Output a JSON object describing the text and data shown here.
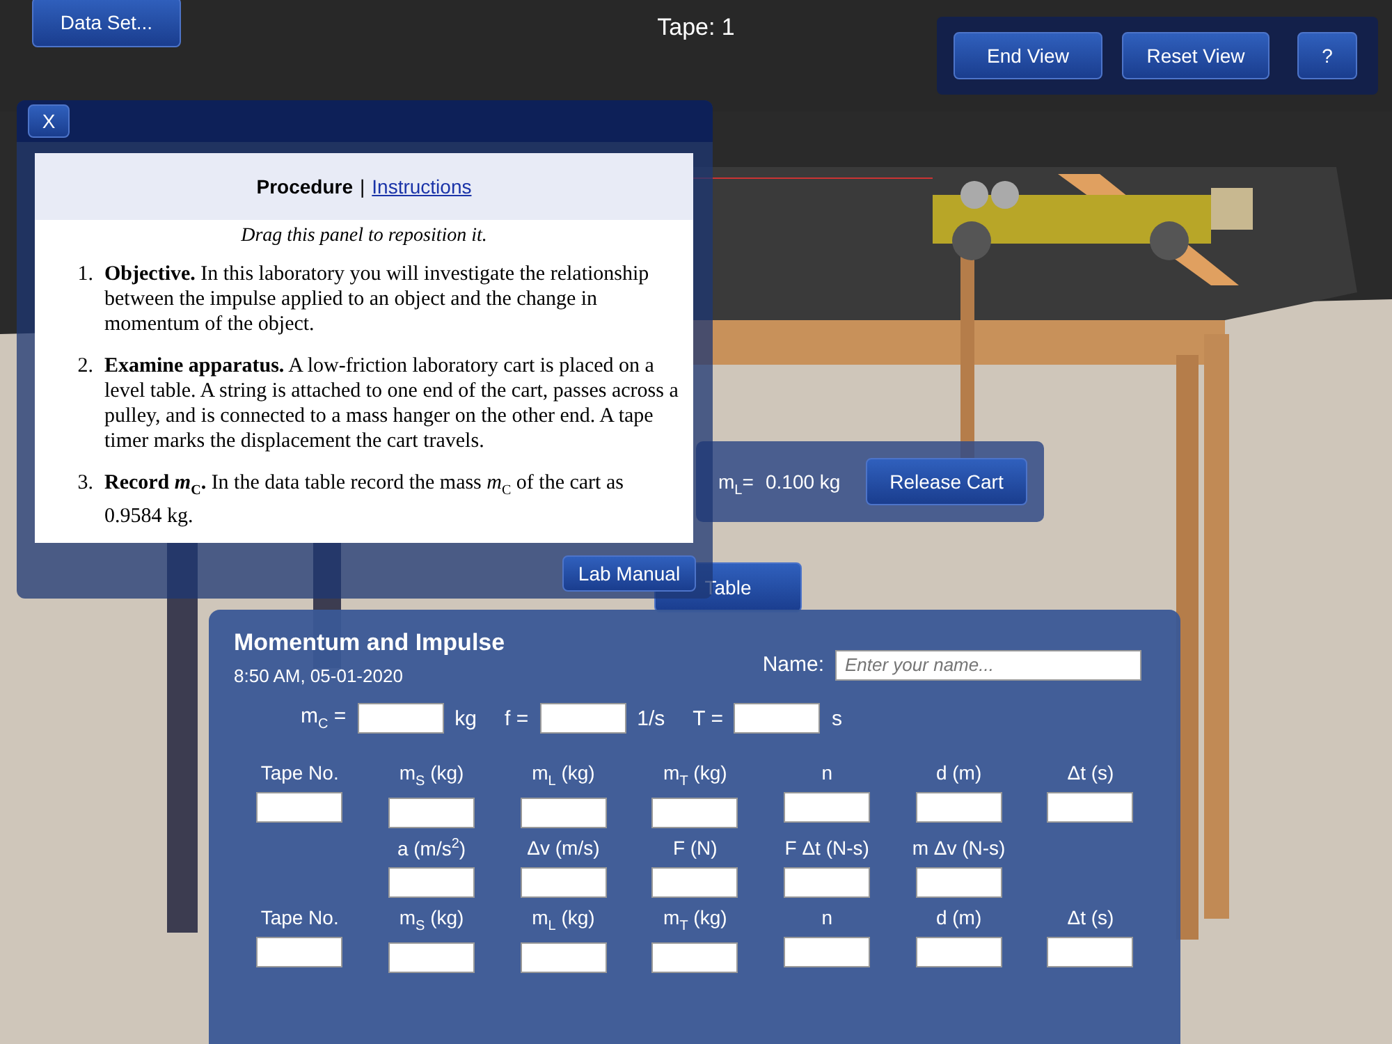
{
  "toolbar": {
    "data_set_button": "Data Set...",
    "tape_label": "Tape: 1",
    "view_buttons": [
      "End View",
      "Reset View",
      "?"
    ]
  },
  "procedure_panel": {
    "close_button": "X",
    "header_title": "Procedure",
    "header_separator": "|",
    "header_link": "Instructions",
    "hint": "Drag this panel to reposition it.",
    "steps": [
      {
        "number": "1.",
        "text": "**Objective.** In this laboratory you will investigate the relationship between the impulse applied to an object and the change in momentum of the object."
      },
      {
        "number": "2.",
        "text": "**Examine apparatus.** A low-friction laboratory cart is placed on a level table. A string is attached to one end of the cart, passes across a pulley, and is connected to a mass hanger on the other end. A tape timer marks the displacement the cart travels."
      },
      {
        "number": "3.",
        "text": "**Record *m*$_{C}$.** In the data table record the mass *m*$_{C}$ of the cart as 0.9584 kg."
      }
    ],
    "lab_manual_button": "Lab Manual"
  },
  "release_panel": {
    "mass_label": "m$_{L}$=",
    "mass_value": "0.100 kg",
    "release_button": "Release Cart"
  },
  "table_tab": "Table",
  "data_panel": {
    "title": "Momentum and Impulse",
    "timestamp": "8:50 AM, 05-01-2020",
    "name_label": "Name:",
    "name_placeholder": "Enter your name...",
    "constants": [
      {
        "label": "m$_{C}$ =",
        "unit": "kg"
      },
      {
        "label": "f =",
        "unit": "1/s"
      },
      {
        "label": "T =",
        "unit": "s"
      }
    ],
    "sections": [
      {
        "kind": "tape",
        "headers": [
          "Tape No.",
          "m$_{S}$ (kg)",
          "m$_{L}$ (kg)",
          "m$_{T}$ (kg)",
          "n",
          "d (m)",
          "Δt (s)"
        ]
      },
      {
        "kind": "results",
        "headers": [
          "a (m/s$^{2}$)",
          "Δv (m/s)",
          "F (N)",
          "F Δt (N-s)",
          "m Δv (N-s)"
        ]
      },
      {
        "kind": "tape",
        "headers": [
          "Tape No.",
          "m$_{S}$ (kg)",
          "m$_{L}$ (kg)",
          "m$_{T}$ (kg)",
          "n",
          "d (m)",
          "Δt (s)"
        ]
      }
    ]
  }
}
